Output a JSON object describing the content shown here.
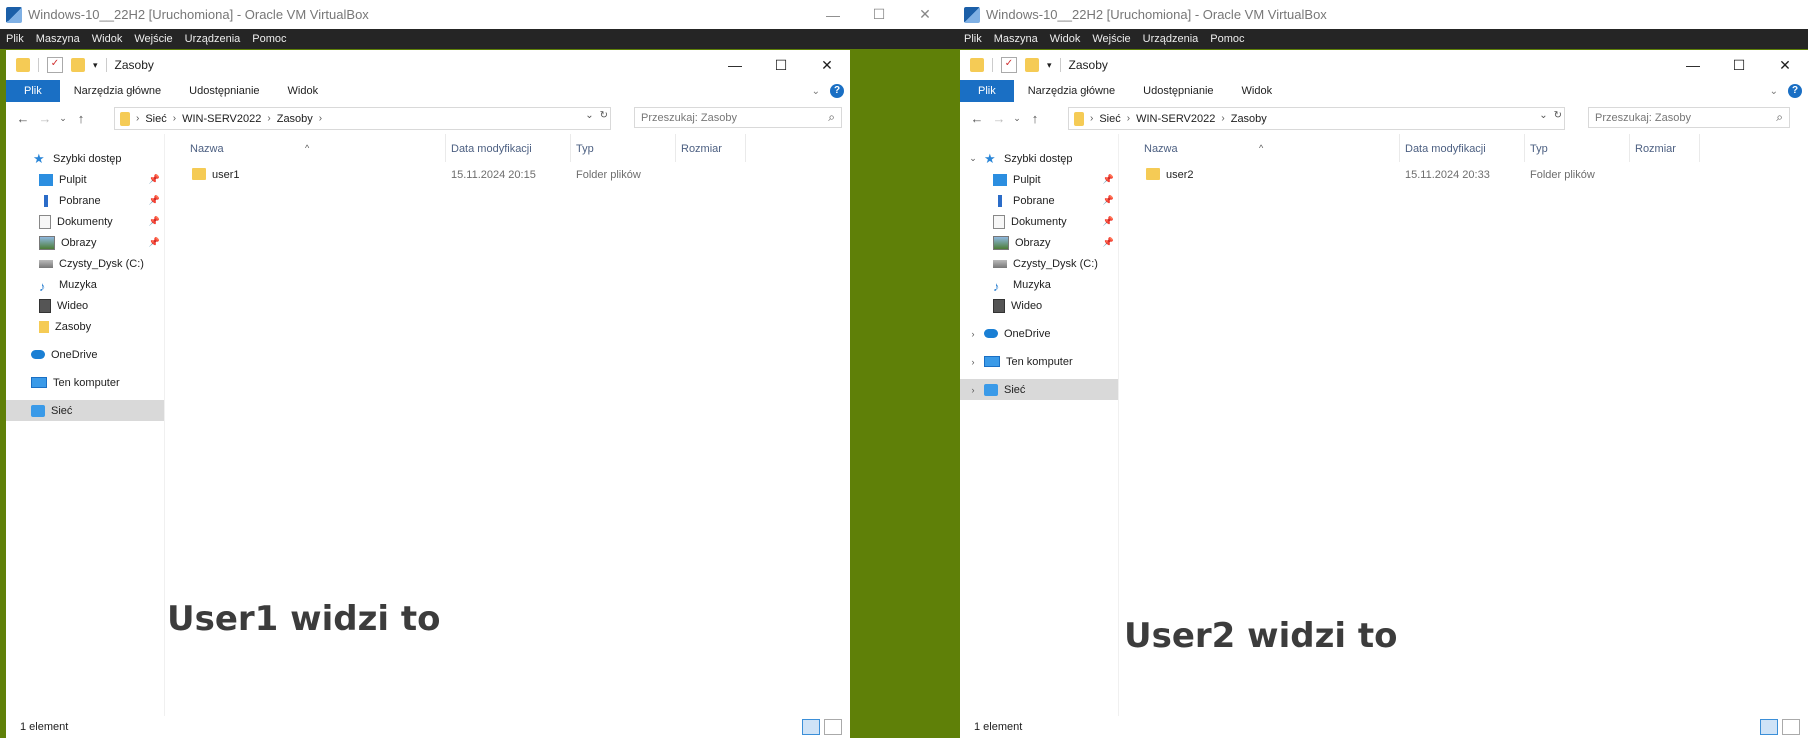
{
  "virtualbox": {
    "title": "Windows-10__22H2 [Uruchomiona] - Oracle VM VirtualBox",
    "menu": [
      "Plik",
      "Maszyna",
      "Widok",
      "Wejście",
      "Urządzenia",
      "Pomoc"
    ],
    "controls": {
      "minimize": "—",
      "maximize": "☐",
      "close": "✕"
    }
  },
  "explorer": {
    "window_title": "Zasoby",
    "ribbon_tabs": [
      "Plik",
      "Narzędzia główne",
      "Udostępnianie",
      "Widok"
    ],
    "breadcrumb": [
      "Sieć",
      "WIN-SERV2022",
      "Zasoby"
    ],
    "search_placeholder": "Przeszukaj: Zasoby",
    "columns": [
      "Nazwa",
      "Data modyfikacji",
      "Typ",
      "Rozmiar"
    ],
    "nav_quick_access": "Szybki dostęp",
    "nav_items": [
      {
        "label": "Pulpit",
        "pinned": true
      },
      {
        "label": "Pobrane",
        "pinned": true
      },
      {
        "label": "Dokumenty",
        "pinned": true
      },
      {
        "label": "Obrazy",
        "pinned": true
      },
      {
        "label": "Czysty_Dysk (C:)",
        "pinned": false
      },
      {
        "label": "Muzyka",
        "pinned": false
      },
      {
        "label": "Wideo",
        "pinned": false
      },
      {
        "label": "Zasoby",
        "pinned": false
      }
    ],
    "nav_onedrive": "OneDrive",
    "nav_pc": "Ten komputer",
    "nav_network": "Sieć",
    "status": "1 element",
    "help": "?"
  },
  "left": {
    "file": {
      "name": "user1",
      "date": "15.11.2024 20:15",
      "type": "Folder plików"
    },
    "caption": "User1 widzi to"
  },
  "right": {
    "file": {
      "name": "user2",
      "date": "15.11.2024 20:33",
      "type": "Folder plików"
    },
    "caption": "User2 widzi to"
  },
  "colors": {
    "accent": "#1a6fc4",
    "desktop": "#5f8008",
    "menubar": "#252525"
  }
}
